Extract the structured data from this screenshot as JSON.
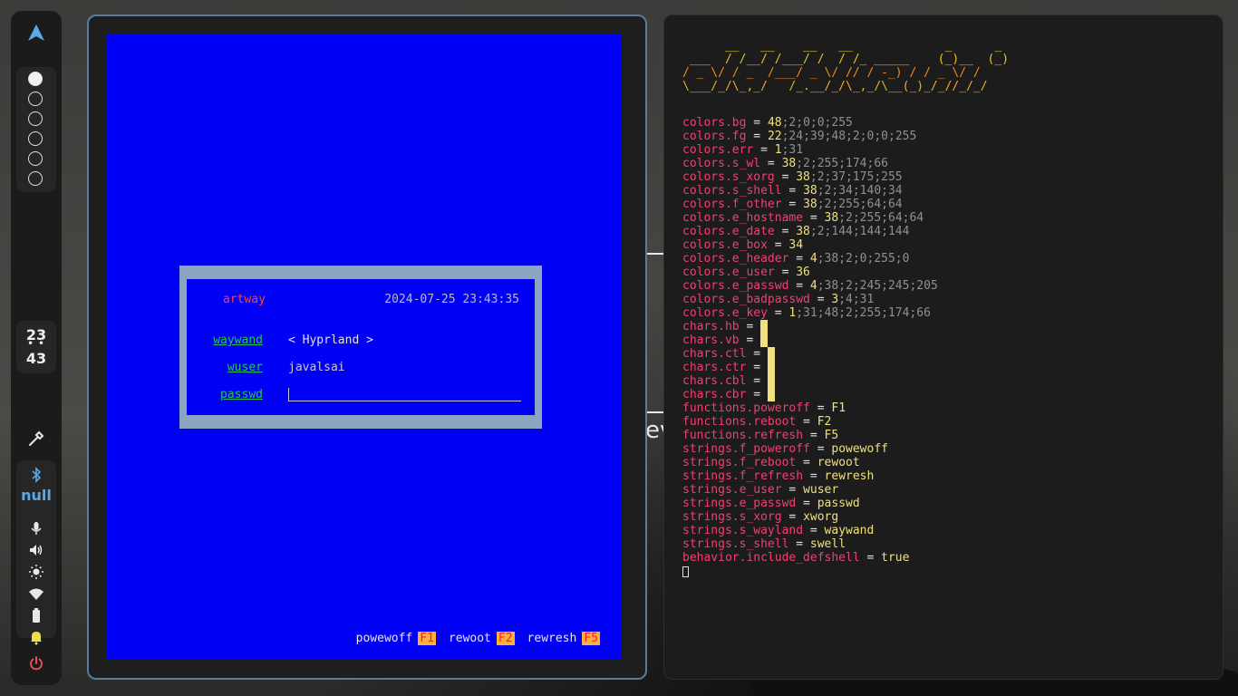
{
  "sidebar": {
    "workspaces": [
      {
        "active": true
      },
      {
        "active": false
      },
      {
        "active": false
      },
      {
        "active": false
      },
      {
        "active": false
      },
      {
        "active": false
      }
    ],
    "clock": {
      "hour": "23",
      "sep": "• •",
      "minute": "43"
    },
    "bluetooth_label": "null",
    "icons": [
      "arch-logo-icon",
      "color-picker-icon",
      "bluetooth-icon",
      "microphone-icon",
      "volume-icon",
      "brightness-icon",
      "wifi-icon",
      "battery-icon",
      "notification-bell-icon",
      "power-icon"
    ]
  },
  "ly": {
    "hostname": "artway",
    "datetime": "2024-07-25 23:43:35",
    "session_label": "waywand",
    "session_value": "< Hyprland >",
    "user_label": "wuser",
    "user_value": "javalsai",
    "passwd_label": "passwd",
    "footer": [
      {
        "label": "powewoff",
        "key": "F1"
      },
      {
        "label": "rewoot",
        "key": "F2"
      },
      {
        "label": "rewresh",
        "key": "F5"
      }
    ]
  },
  "wallpaper_text": "ev",
  "terminal": {
    "ascii": [
      "      __   __    __   __             _      _ ",
      " ___  / /__/ /___/ /  / /_ _____    (_)__  (_)",
      "/ _ \\/ / _  /___/ _ \\/ // / -_) / / _ \\/ / ",
      "\\___/_/\\_,_/   /_.__/_/\\_,_/\\__(_)_/_//_/_/  "
    ],
    "config": [
      {
        "k": "colors.bg",
        "v1": "48",
        "v2": ";2;0;0;255"
      },
      {
        "k": "colors.fg",
        "v1": "22",
        "v2": ";24;39;48;2;0;0;255"
      },
      {
        "k": "colors.err",
        "v1": "1",
        "v2": ";31"
      },
      {
        "k": "colors.s_wl",
        "v1": "38",
        "v2": ";2;255;174;66"
      },
      {
        "k": "colors.s_xorg",
        "v1": "38",
        "v2": ";2;37;175;255"
      },
      {
        "k": "colors.s_shell",
        "v1": "38",
        "v2": ";2;34;140;34"
      },
      {
        "k": "colors.f_other",
        "v1": "38",
        "v2": ";2;255;64;64"
      },
      {
        "k": "colors.e_hostname",
        "v1": "38",
        "v2": ";2;255;64;64"
      },
      {
        "k": "colors.e_date",
        "v1": "38",
        "v2": ";2;144;144;144"
      },
      {
        "k": "colors.e_box",
        "v1": "34",
        "v2": ""
      },
      {
        "k": "colors.e_header",
        "v1": "4",
        "v2": ";38;2;0;255;0"
      },
      {
        "k": "colors.e_user",
        "v1": "36",
        "v2": ""
      },
      {
        "k": "colors.e_passwd",
        "v1": "4",
        "v2": ";38;2;245;245;205"
      },
      {
        "k": "colors.e_badpasswd",
        "v1": "3",
        "v2": ";4;31"
      },
      {
        "k": "colors.e_key",
        "v1": "1",
        "v2": ";31;48;2;255;174;66"
      }
    ],
    "chars": [
      {
        "k": "chars.hb"
      },
      {
        "k": "chars.vb"
      },
      {
        "k": "chars.ctl"
      },
      {
        "k": "chars.ctr"
      },
      {
        "k": "chars.cbl"
      },
      {
        "k": "chars.cbr"
      }
    ],
    "settings": [
      {
        "k": "functions.poweroff",
        "v": "F1"
      },
      {
        "k": "functions.reboot",
        "v": "F2"
      },
      {
        "k": "functions.refresh",
        "v": "F5"
      },
      {
        "k": "strings.f_poweroff",
        "v": "powewoff"
      },
      {
        "k": "strings.f_reboot",
        "v": "rewoot"
      },
      {
        "k": "strings.f_refresh",
        "v": "rewresh"
      },
      {
        "k": "strings.e_user",
        "v": "wuser"
      },
      {
        "k": "strings.e_passwd",
        "v": "passwd"
      },
      {
        "k": "strings.s_xorg",
        "v": "xworg"
      },
      {
        "k": "strings.s_wayland",
        "v": "waywand"
      },
      {
        "k": "strings.s_shell",
        "v": "swell"
      },
      {
        "k": "behavior.include_defshell",
        "v": "true"
      }
    ],
    "equals": " = "
  }
}
